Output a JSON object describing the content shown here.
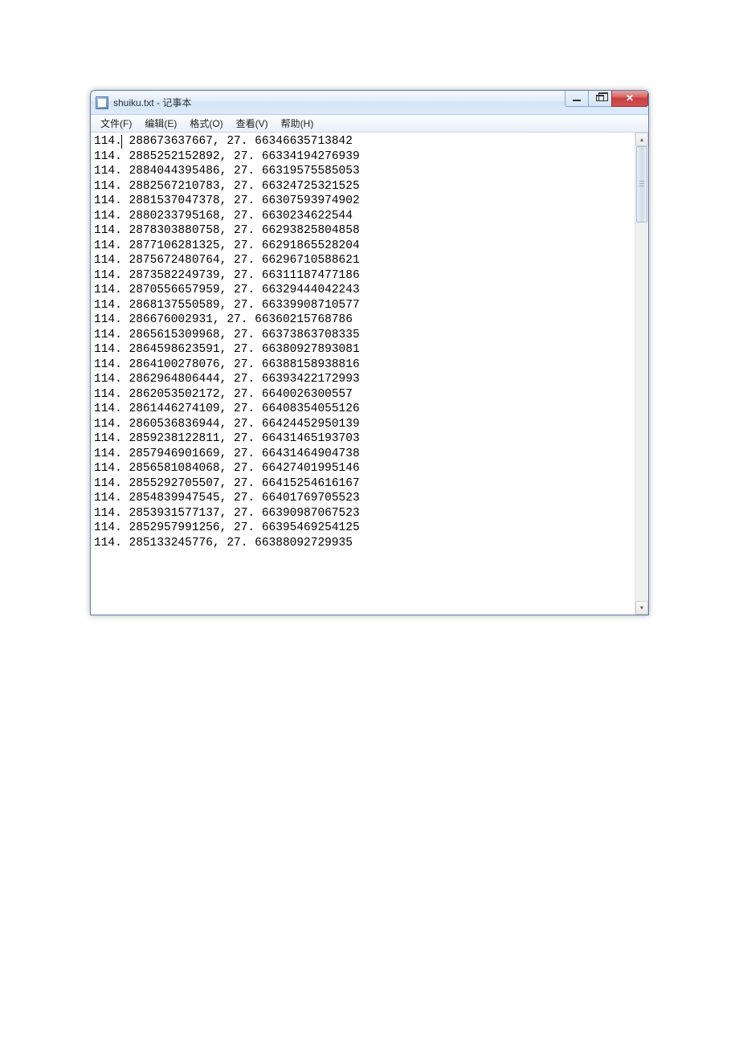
{
  "window": {
    "title": "shuiku.txt - 记事本"
  },
  "menu": {
    "file": "文件(F)",
    "edit": "编辑(E)",
    "format": "格式(O)",
    "view": "查看(V)",
    "help": "帮助(H)"
  },
  "content": {
    "lines": [
      "114. 288673637667, 27. 66346635713842",
      "114. 2885252152892, 27. 66334194276939",
      "114. 2884044395486, 27. 66319575585053",
      "114. 2882567210783, 27. 66324725321525",
      "114. 2881537047378, 27. 66307593974902",
      "114. 2880233795168, 27. 6630234622544",
      "114. 2878303880758, 27. 66293825804858",
      "114. 2877106281325, 27. 66291865528204",
      "114. 2875672480764, 27. 66296710588621",
      "114. 2873582249739, 27. 66311187477186",
      "114. 2870556657959, 27. 66329444042243",
      "114. 2868137550589, 27. 66339908710577",
      "114. 286676002931, 27. 66360215768786",
      "114. 2865615309968, 27. 66373863708335",
      "114. 2864598623591, 27. 66380927893081",
      "114. 2864100278076, 27. 66388158938816",
      "114. 2862964806444, 27. 66393422172993",
      "114. 2862053502172, 27. 6640026300557",
      "114. 2861446274109, 27. 66408354055126",
      "114. 2860536836944, 27. 66424452950139",
      "114. 2859238122811, 27. 66431465193703",
      "114. 2857946901669, 27. 66431464904738",
      "114. 2856581084068, 27. 66427401995146",
      "114. 2855292705507, 27. 66415254616167",
      "114. 2854839947545, 27. 66401769705523",
      "114. 2853931577137, 27. 66390987067523",
      "114. 2852957991256, 27. 66395469254125",
      "114. 285133245776, 27. 66388092729935"
    ]
  }
}
